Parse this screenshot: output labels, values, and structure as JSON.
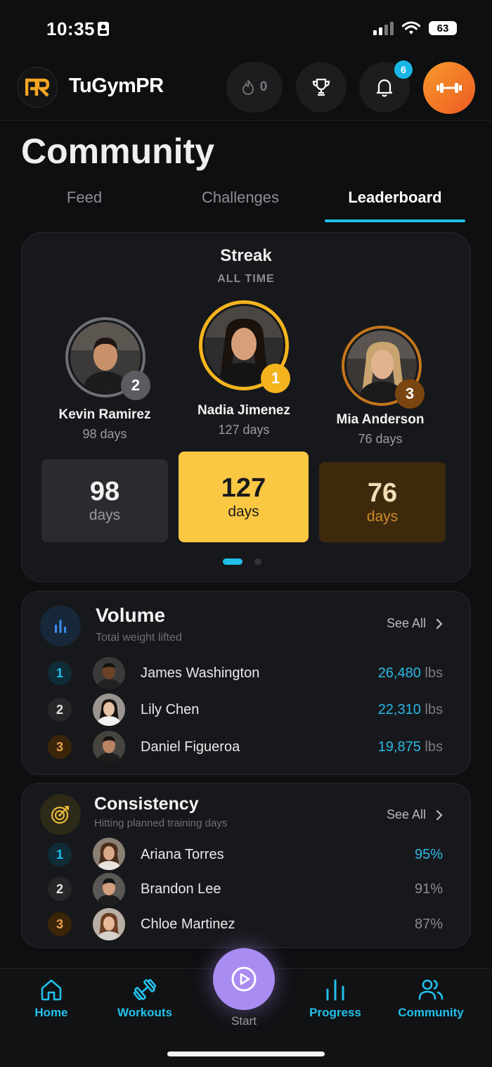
{
  "status_bar": {
    "time": "10:35",
    "battery": "63"
  },
  "header": {
    "brand": "TuGymPR",
    "streak_count": "0",
    "notification_count": "6"
  },
  "page": {
    "title": "Community"
  },
  "tabs": [
    {
      "label": "Feed",
      "active": false
    },
    {
      "label": "Challenges",
      "active": false
    },
    {
      "label": "Leaderboard",
      "active": true
    }
  ],
  "streak": {
    "title": "Streak",
    "subtitle": "ALL TIME",
    "podium": [
      {
        "rank": "2",
        "name": "Kevin Ramirez",
        "days_text": "98 days",
        "value": "98",
        "unit": "days"
      },
      {
        "rank": "1",
        "name": "Nadia Jimenez",
        "days_text": "127 days",
        "value": "127",
        "unit": "days"
      },
      {
        "rank": "3",
        "name": "Mia Anderson",
        "days_text": "76 days",
        "value": "76",
        "unit": "days"
      }
    ],
    "pager": {
      "pages": 2,
      "current": 1
    }
  },
  "volume": {
    "title": "Volume",
    "subtitle": "Total weight lifted",
    "see_all": "See All",
    "rows": [
      {
        "rank": "1",
        "name": "James Washington",
        "value": "26,480",
        "unit": "lbs"
      },
      {
        "rank": "2",
        "name": "Lily Chen",
        "value": "22,310",
        "unit": "lbs"
      },
      {
        "rank": "3",
        "name": "Daniel Figueroa",
        "value": "19,875",
        "unit": "lbs"
      }
    ]
  },
  "consistency": {
    "title": "Consistency",
    "subtitle": "Hitting planned training days",
    "see_all": "See All",
    "rows": [
      {
        "rank": "1",
        "name": "Ariana Torres",
        "value": "95%"
      },
      {
        "rank": "2",
        "name": "Brandon Lee",
        "value": "91%"
      },
      {
        "rank": "3",
        "name": "Chloe Martinez",
        "value": "87%"
      }
    ]
  },
  "nav": {
    "home": "Home",
    "workouts": "Workouts",
    "start": "Start",
    "progress": "Progress",
    "community": "Community"
  },
  "colors": {
    "accent_cyan": "#1fbfe9",
    "gold": "#f5b41e",
    "bronze": "#c4761c",
    "silver": "#8a8b8f",
    "start_purple": "#a98cf2"
  },
  "icons": [
    "person-badge-icon",
    "signal-icon",
    "wifi-icon",
    "battery-icon",
    "flame-icon",
    "trophy-icon",
    "bell-icon",
    "dumbbell-icon",
    "bar-chart-icon",
    "target-icon",
    "chevron-right-icon",
    "home-icon",
    "workouts-dumbbell-icon",
    "play-icon",
    "progress-bars-icon",
    "community-people-icon"
  ]
}
